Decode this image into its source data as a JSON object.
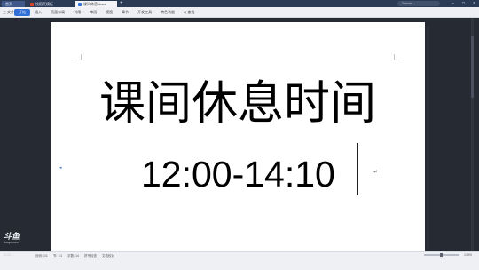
{
  "titlebar": {
    "tabs": [
      {
        "label": "首页"
      },
      {
        "label": "找稻壳模板"
      },
      {
        "label": "课间休息.docx"
      }
    ],
    "add_tab": "+",
    "user": "Tutorial…",
    "controls": [
      "−",
      "□",
      "×"
    ]
  },
  "menubar": {
    "file": "三 文件",
    "items": [
      "开始",
      "插入",
      "页面布局",
      "引用",
      "审阅",
      "视图",
      "章节",
      "开发工具",
      "特色功能",
      "Q 查找"
    ]
  },
  "document": {
    "heading": "课间休息时间",
    "times": "12:00-14:10",
    "para_mark": "↵"
  },
  "watermark": {
    "logo": "斗鱼",
    "tagline": "douyu.com",
    "id": "8136..."
  },
  "statusbar": {
    "left": [
      "页码: 1/1",
      "节: 1/1",
      "字数: 14",
      "拼写检查",
      "文档校对"
    ],
    "zoom": "135%"
  }
}
